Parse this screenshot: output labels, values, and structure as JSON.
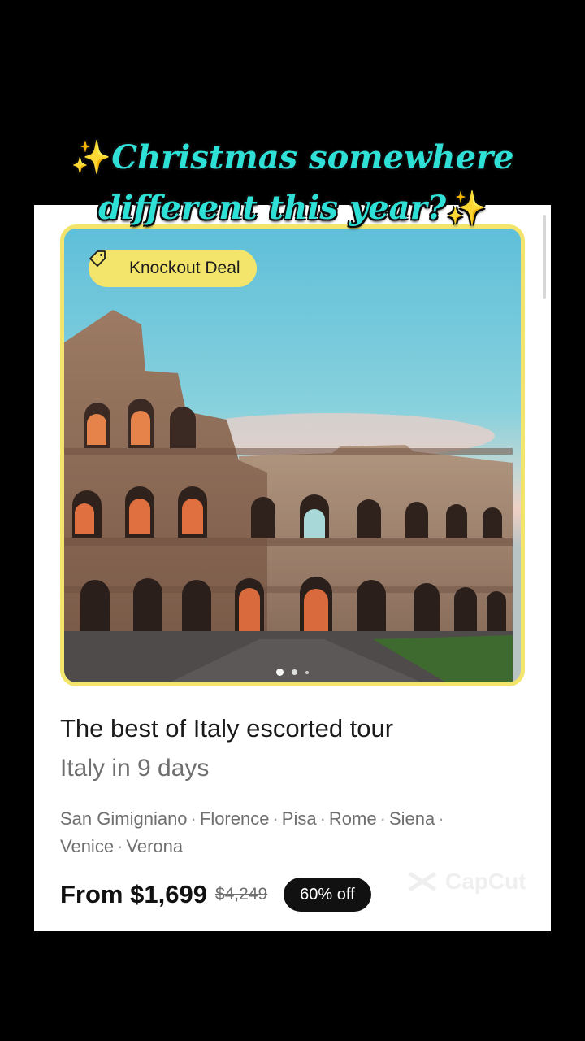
{
  "overlay": {
    "line1": "Christmas somewhere",
    "line2": "different this year?",
    "sparkle": "✨"
  },
  "card": {
    "badge_label": "Knockout Deal",
    "badge_icon": "tag-icon",
    "photo_icon": "colosseum-photo",
    "carousel_pages": 3,
    "carousel_active": 1,
    "title": "The best of Italy escorted tour",
    "subtitle": "Italy in 9 days",
    "cities": [
      "San Gimigniano",
      "Florence",
      "Pisa",
      "Rome",
      "Siena",
      "Venice",
      "Verona"
    ],
    "city_separator": "·",
    "price_from": "From $1,699",
    "price_was": "$4,249",
    "discount": "60% off"
  },
  "watermark": {
    "text": "CapCut"
  },
  "colors": {
    "badge_yellow": "#f3e56b",
    "headline_cyan": "#2fe0d6",
    "pill_black": "#111111"
  }
}
